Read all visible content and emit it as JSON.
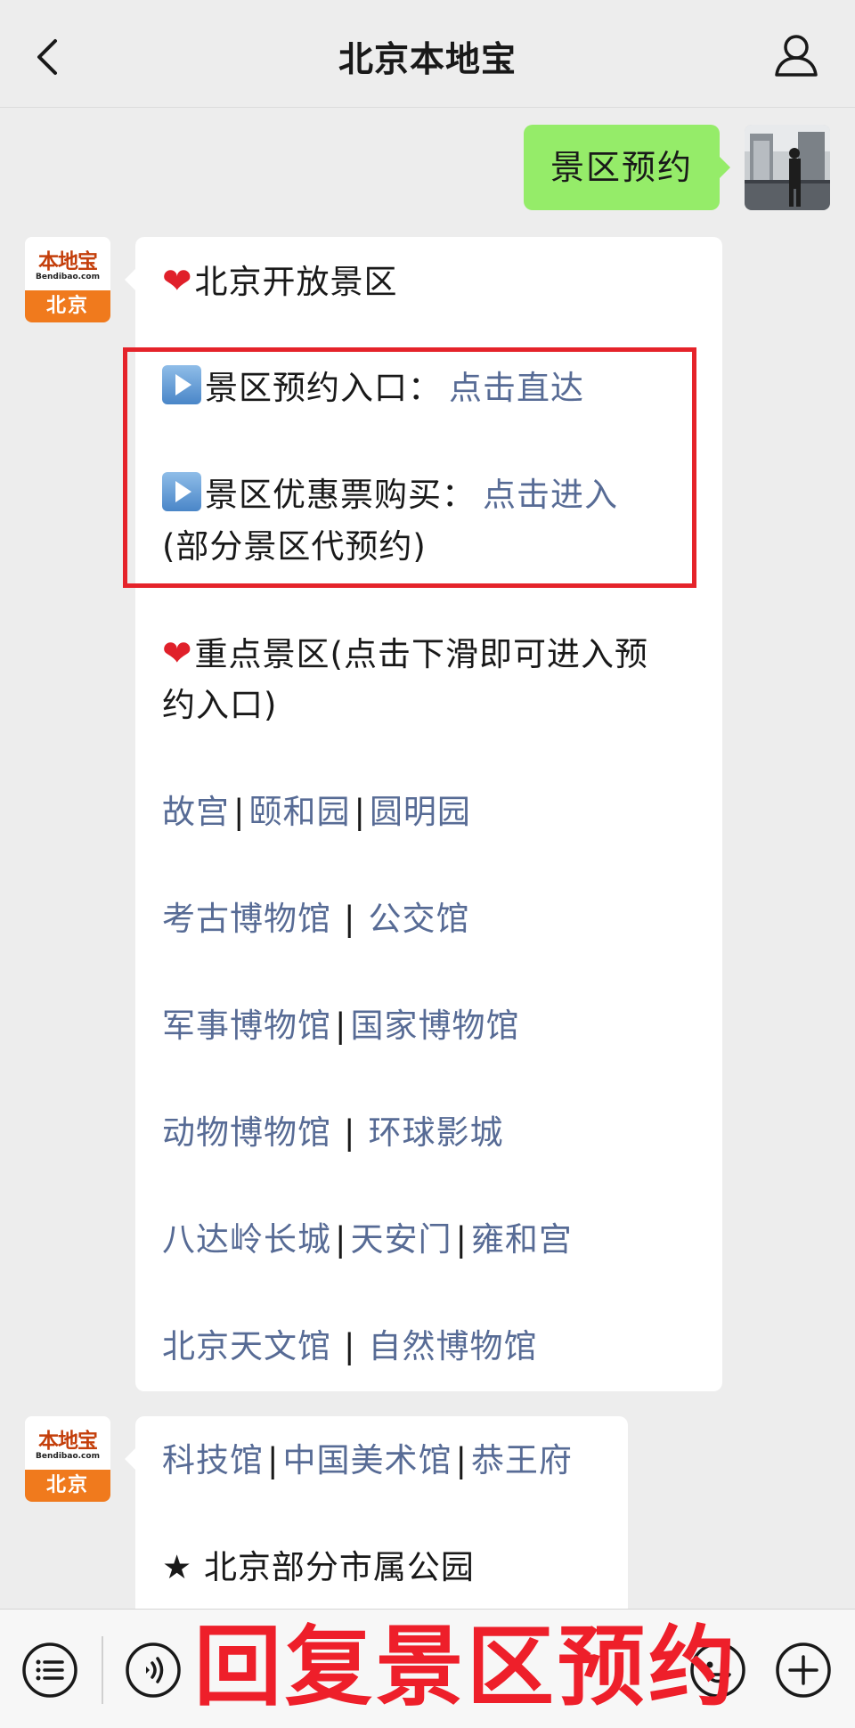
{
  "header": {
    "title": "北京本地宝",
    "back_icon": "chevron-left-icon",
    "profile_icon": "person-icon"
  },
  "user_message": {
    "text": "景区预约"
  },
  "bot_avatar": {
    "logo_text": "本地宝",
    "logo_sub": "Bendibao.com",
    "city": "北京"
  },
  "message1": {
    "heading": "北京开放景区",
    "reserve_label": "景区预约入口：",
    "reserve_link": "点击直达",
    "discount_label": "景区优惠票购买：",
    "discount_link": "点击进入",
    "discount_note": "(部分景区代预约)",
    "key_heading_line1": "重点景区(点击下滑即可进入预",
    "key_heading_line2": "约入口)",
    "attraction_rows": [
      [
        "故宫",
        "颐和园",
        "圆明园"
      ],
      [
        "考古博物馆",
        "公交馆"
      ],
      [
        "军事博物馆",
        "国家博物馆"
      ],
      [
        "动物博物馆",
        "环球影城"
      ],
      [
        "八达岭长城",
        "天安门",
        "雍和宫"
      ],
      [
        "北京天文馆",
        "自然博物馆"
      ]
    ]
  },
  "message2": {
    "links": [
      "科技馆",
      "中国美术馆",
      "恭王府"
    ],
    "star": "★",
    "parks_heading": "北京部分市属公园"
  },
  "separator": "|",
  "bottom_bar": {
    "menu_icon": "list-menu-icon",
    "voice_icon": "voice-icon",
    "emoji_icon": "emoji-icon",
    "add_icon": "plus-icon",
    "overlay_text": "回复景区预约"
  },
  "colors": {
    "link": "#576b95",
    "user_bubble": "#95ec69",
    "highlight_border": "#e5232a",
    "overlay_text": "#ee1f2a"
  }
}
